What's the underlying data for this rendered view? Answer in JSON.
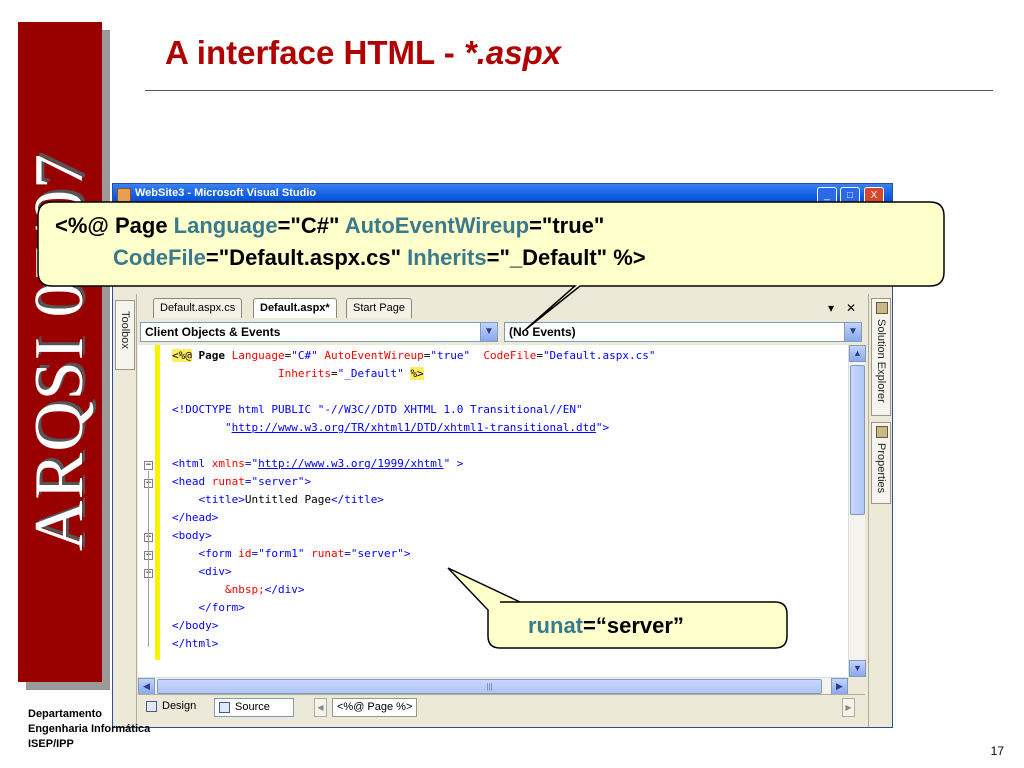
{
  "slide": {
    "title_main": "A interface HTML - ",
    "title_ext": "*.aspx",
    "band_text": "ARQSI 07/07",
    "page_number": "17",
    "footer": [
      "Departamento",
      "Engenharia Informática",
      "ISEP/IPP"
    ]
  },
  "window": {
    "title": "WebSite3 - Microsoft Visual Studio",
    "min_label": "_",
    "max_label": "□",
    "close_label": "X"
  },
  "toolbox_label": "Toolbox",
  "side_tabs": {
    "solution_explorer": "Solution Explorer",
    "properties": "Properties"
  },
  "doc_tabs": {
    "tab1": "Default.aspx.cs",
    "tab2": "Default.aspx*",
    "tab3": "Start Page",
    "dropdown_ctrl": "▾",
    "close_ctrl": "✕"
  },
  "dropdowns": {
    "objects": "Client Objects & Events",
    "events": "(No Events)"
  },
  "code": {
    "l1": {
      "lt": "<%@",
      "page": " Page ",
      "lang_attr": "Language",
      "lang_val": "\"C#\"",
      "wire_attr": "AutoEventWireup",
      "wire_val": "\"true\"",
      "cf_attr": "CodeFile",
      "cf_val": "\"Default.aspx.cs\""
    },
    "l2": {
      "inh_attr": "Inherits",
      "inh_val": "\"_Default\"",
      "end": "%>"
    },
    "l4": {
      "text": "<!DOCTYPE html PUBLIC \"-//W3C//DTD XHTML 1.0 Transitional//EN\""
    },
    "l5": {
      "q1": "\"",
      "url": "http://www.w3.org/TR/xhtml1/DTD/xhtml1-transitional.dtd",
      "q2": "\">"
    },
    "l7": {
      "open": "<html",
      "attr": " xmlns",
      "eq": "=\"",
      "url": "http://www.w3.org/1999/xhtml",
      "close": "\" >"
    },
    "l8": {
      "open": "<head",
      "attr": " runat",
      "val": "=\"server\"",
      "close": ">"
    },
    "l9": {
      "open": "<title>",
      "text": "Untitled Page",
      "close": "</title>"
    },
    "l10": {
      "text": "</head>"
    },
    "l11": {
      "text": "<body>"
    },
    "l12": {
      "open": "<form",
      "id_attr": " id",
      "id_val": "=\"form1\"",
      "runat_attr": " runat",
      "runat_val": "=\"server\"",
      "close": ">"
    },
    "l13": {
      "text": "<div>"
    },
    "l14": {
      "nbsp": "&nbsp;",
      "close": "</div>"
    },
    "l15": {
      "text": "</form>"
    },
    "l16": {
      "text": "</body>"
    },
    "l17": {
      "text": "</html>"
    }
  },
  "bottom_bar": {
    "design": "Design",
    "source": "Source",
    "crumb": "<%@ Page %>"
  },
  "callout_page": {
    "l1_open": "<%@ Page ",
    "lang_attr": "Language",
    "lang_val": "=\"C#\" ",
    "wire_attr": "AutoEventWireup",
    "wire_val": "=\"true\"",
    "cf_attr": "CodeFile",
    "cf_val": "=\"Default.aspx.cs\" ",
    "inh_attr": "Inherits",
    "inh_val": "=\"_Default\" %>"
  },
  "callout_runat": {
    "attr": "runat",
    "val": "=“server”"
  }
}
